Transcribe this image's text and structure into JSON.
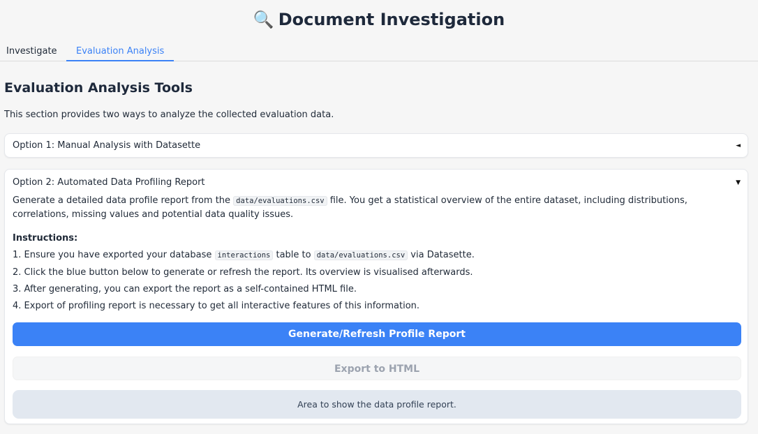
{
  "app": {
    "title": "Document Investigation",
    "title_icon": "🔍"
  },
  "tabs": [
    {
      "label": "Investigate",
      "active": false
    },
    {
      "label": "Evaluation Analysis",
      "active": true
    }
  ],
  "section": {
    "heading": "Evaluation Analysis Tools",
    "intro": "This section provides two ways to analyze the collected evaluation data."
  },
  "accordions": [
    {
      "title": "Option 1: Manual Analysis with Datasette",
      "state": "collapsed",
      "caret": "◄"
    },
    {
      "title": "Option 2: Automated Data Profiling Report",
      "state": "expanded",
      "caret": "▼",
      "description": {
        "before": "Generate a detailed data profile report from the ",
        "code": "data/evaluations.csv",
        "after": " file. You get a statistical overview of the entire dataset, including distributions, correlations, missing values and potential data quality issues."
      },
      "instructions_title": "Instructions:",
      "instructions": {
        "step1": {
          "a": "1. Ensure you have exported your database ",
          "code1": "interactions",
          "b": " table to ",
          "code2": "data/evaluations.csv",
          "c": " via Datasette."
        },
        "step2": "2. Click the blue button below to generate or refresh the report. Its overview is visualised afterwards.",
        "step3": "3. After generating, you can export the report as a self-contained HTML file.",
        "step4": "4. Export of profiling report is necessary to get all interactive features of this information."
      },
      "buttons": {
        "generate": "Generate/Refresh Profile Report",
        "export": "Export to HTML"
      },
      "output_placeholder": "Area to show the data profile report."
    }
  ],
  "colors": {
    "accent": "#3b82f6",
    "background": "#f6f6f6",
    "output_area": "#e2e8f0"
  }
}
